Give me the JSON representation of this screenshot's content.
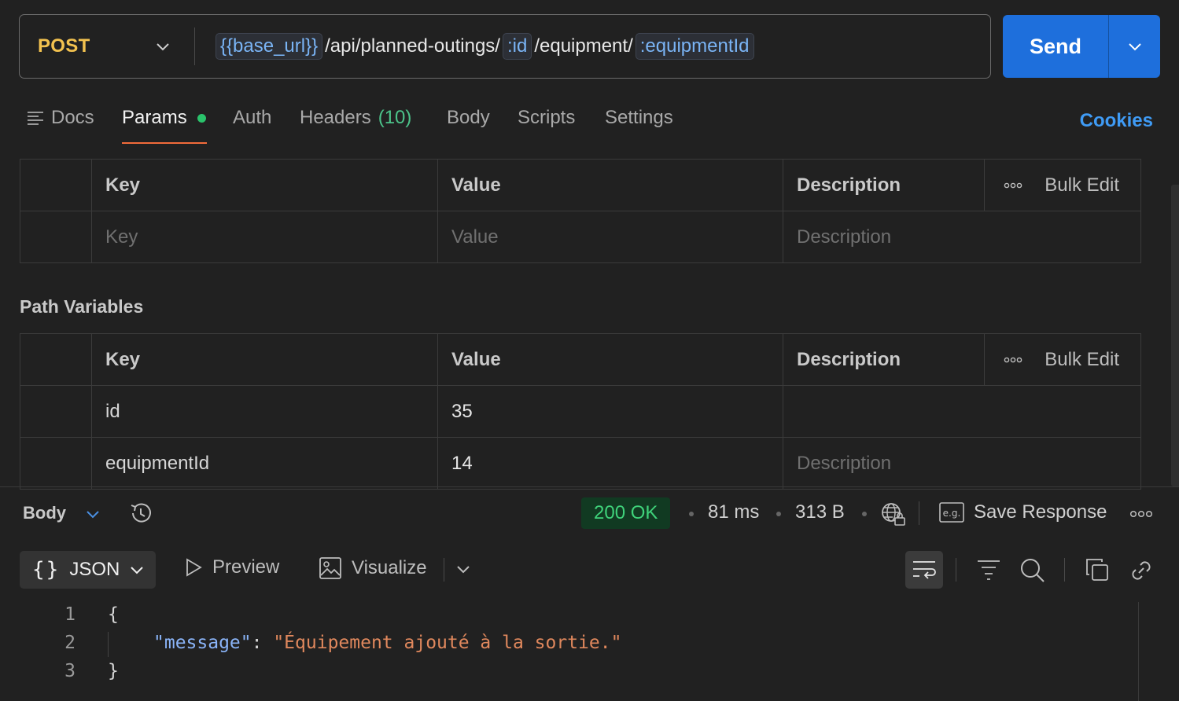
{
  "request": {
    "method": "POST",
    "url": {
      "base_var": "{{base_url}}",
      "seg1": "/api/planned-outings/",
      "var_id": ":id",
      "seg2": "/equipment/",
      "var_equipment": ":equipmentId"
    },
    "send_label": "Send"
  },
  "tabs": {
    "docs": "Docs",
    "params": "Params",
    "auth": "Auth",
    "headers": "Headers",
    "headers_count": "(10)",
    "body": "Body",
    "scripts": "Scripts",
    "settings": "Settings",
    "cookies": "Cookies"
  },
  "query_params": {
    "headers": {
      "key": "Key",
      "value": "Value",
      "description": "Description",
      "bulk_edit": "Bulk Edit"
    },
    "placeholder": {
      "key": "Key",
      "value": "Value",
      "description": "Description"
    }
  },
  "path_variables": {
    "title": "Path Variables",
    "headers": {
      "key": "Key",
      "value": "Value",
      "description": "Description",
      "bulk_edit": "Bulk Edit"
    },
    "rows": [
      {
        "key": "id",
        "value": "35",
        "description": ""
      },
      {
        "key": "equipmentId",
        "value": "14",
        "description": "Description"
      }
    ]
  },
  "response": {
    "body_label": "Body",
    "status": "200 OK",
    "time": "81 ms",
    "size": "313 B",
    "save_response": "Save Response",
    "format": "JSON",
    "preview": "Preview",
    "visualize": "Visualize",
    "lines": [
      {
        "num": "1",
        "open": "{"
      },
      {
        "num": "2",
        "key": "\"message\"",
        "colon": ": ",
        "value": "\"Équipement ajouté à la sortie.\""
      },
      {
        "num": "3",
        "close": "}"
      }
    ]
  },
  "colors": {
    "method": "#f3c24f",
    "send": "#1e6fdc",
    "accent_underline": "#f26b3a",
    "status_ok": "#3fd27a",
    "json_key": "#8ab4f8",
    "json_string": "#e0885d"
  }
}
